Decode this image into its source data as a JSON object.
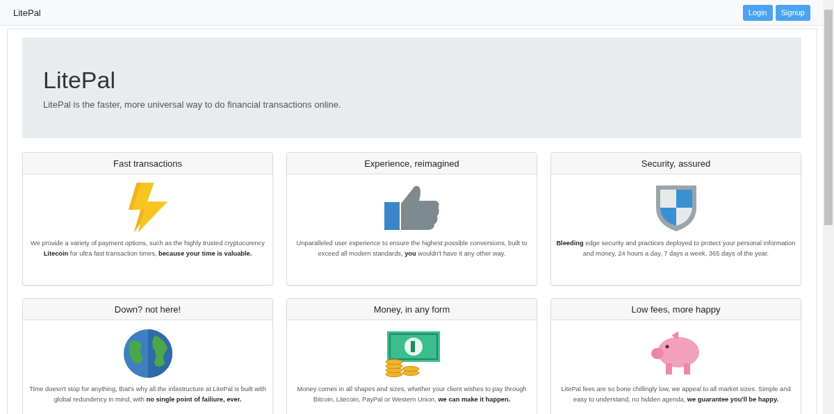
{
  "navbar": {
    "brand": "LitePal",
    "buttons": [
      "Login",
      "Signup"
    ]
  },
  "hero": {
    "title": "LitePal",
    "lead": "LitePal is the faster, more universal way to do financial transactions online."
  },
  "cards": [
    {
      "title": "Fast transactions",
      "kind": "lightning",
      "text": "We provide a variety of payment options, such as the highly trusted cryptocurency **Litecoin** for ultra fast transaction times, **because your time is valuable.**"
    },
    {
      "title": "Experience, reimagined",
      "kind": "thumb",
      "text": "Unparalleled user experience to ensure the highest possible conversions, built to exceed all modern standards, **you** wouldn't have it any other way."
    },
    {
      "title": "Security, assured",
      "kind": "shield",
      "text": "**Bleeding** edge security and practices deployed to protect your personal information and money, 24 hours a day, 7 days a week, 365 days of the year."
    },
    {
      "title": "Down? not here!",
      "kind": "globe",
      "text": "Time doesn't stop for anything, that's why all the infastructure at LitePal is built with global redundency in mind, with **no single point of failiure, ever.**"
    },
    {
      "title": "Money, in any form",
      "kind": "money",
      "text": "Money comes in all shapes and sizes, whether your client wishes to pay through Bitcoin, Litecoin, PayPal or Western Union, **we can make it happen.**"
    },
    {
      "title": "Low fees, more happy",
      "kind": "piggy",
      "text": "LitePal fees are so bone chillingly low, we appeal to all market sizes. Simple and easy to understand, no hidden agenda, **we guarantee you'll be happy.**"
    }
  ]
}
